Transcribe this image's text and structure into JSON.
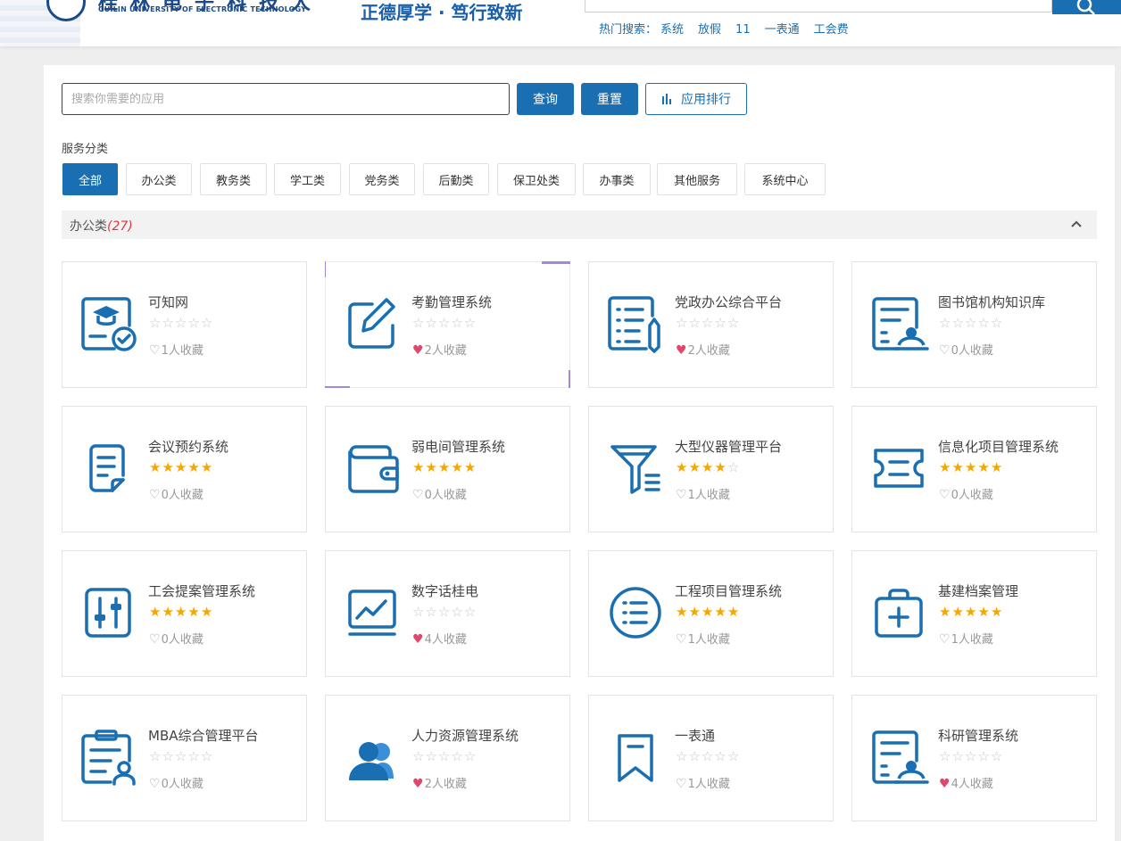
{
  "header": {
    "logo_cn": "桂林电子科技大学",
    "logo_en": "GUILIN UNIVERSITY OF ELECTRONIC TECHNOLOGY",
    "slogan": "正德厚学 · 笃行致新",
    "hot_label": "热门搜索：",
    "hot_terms": [
      "系统",
      "放假",
      "11",
      "一表通",
      "工会费"
    ]
  },
  "search": {
    "placeholder": "搜索你需要的应用",
    "query_label": "查询",
    "reset_label": "重置",
    "rank_label": "应用排行"
  },
  "categories": {
    "title": "服务分类",
    "items": [
      "全部",
      "办公类",
      "教务类",
      "学工类",
      "党务类",
      "后勤类",
      "保卫处类",
      "办事类",
      "其他服务",
      "系统中心"
    ],
    "active": "全部"
  },
  "section": {
    "name": "办公类",
    "count": "(27)"
  },
  "colors": {
    "primary": "#1a6fb3",
    "star": "#f5a700",
    "heart": "#e0476a",
    "count": "#d9383e"
  },
  "apps": [
    {
      "name": "可知网",
      "rating": 0,
      "favorited": false,
      "fav_text": "1人收藏",
      "icon": "certificate-icon"
    },
    {
      "name": "考勤管理系统",
      "rating": 0,
      "favorited": true,
      "fav_text": "2人收藏",
      "icon": "edit-icon"
    },
    {
      "name": "党政办公综合平台",
      "rating": 0,
      "favorited": true,
      "fav_text": "2人收藏",
      "icon": "list-pen-icon"
    },
    {
      "name": "图书馆机构知识库",
      "rating": 0,
      "favorited": false,
      "fav_text": "0人收藏",
      "icon": "reader-doc-icon"
    },
    {
      "name": "会议预约系统",
      "rating": 5,
      "favorited": false,
      "fav_text": "0人收藏",
      "icon": "document-icon"
    },
    {
      "name": "弱电间管理系统",
      "rating": 5,
      "favorited": false,
      "fav_text": "0人收藏",
      "icon": "wallet-icon"
    },
    {
      "name": "大型仪器管理平台",
      "rating": 4,
      "favorited": false,
      "fav_text": "1人收藏",
      "icon": "funnel-icon"
    },
    {
      "name": "信息化项目管理系统",
      "rating": 5,
      "favorited": false,
      "fav_text": "0人收藏",
      "icon": "ticket-icon"
    },
    {
      "name": "工会提案管理系统",
      "rating": 5,
      "favorited": false,
      "fav_text": "0人收藏",
      "icon": "sliders-icon"
    },
    {
      "name": "数字话桂电",
      "rating": 0,
      "favorited": true,
      "fav_text": "4人收藏",
      "icon": "chart-monitor-icon"
    },
    {
      "name": "工程项目管理系统",
      "rating": 5,
      "favorited": false,
      "fav_text": "1人收藏",
      "icon": "list-circle-icon"
    },
    {
      "name": "基建档案管理",
      "rating": 5,
      "favorited": false,
      "fav_text": "1人收藏",
      "icon": "medical-bag-icon"
    },
    {
      "name": "MBA综合管理平台",
      "rating": 0,
      "favorited": false,
      "fav_text": "0人收藏",
      "icon": "clipboard-user-icon"
    },
    {
      "name": "人力资源管理系统",
      "rating": 0,
      "favorited": true,
      "fav_text": "2人收藏",
      "icon": "users-icon"
    },
    {
      "name": "一表通",
      "rating": 0,
      "favorited": false,
      "fav_text": "1人收藏",
      "icon": "bookmark-icon"
    },
    {
      "name": "科研管理系统",
      "rating": 0,
      "favorited": true,
      "fav_text": "4人收藏",
      "icon": "reader-doc-icon"
    }
  ]
}
